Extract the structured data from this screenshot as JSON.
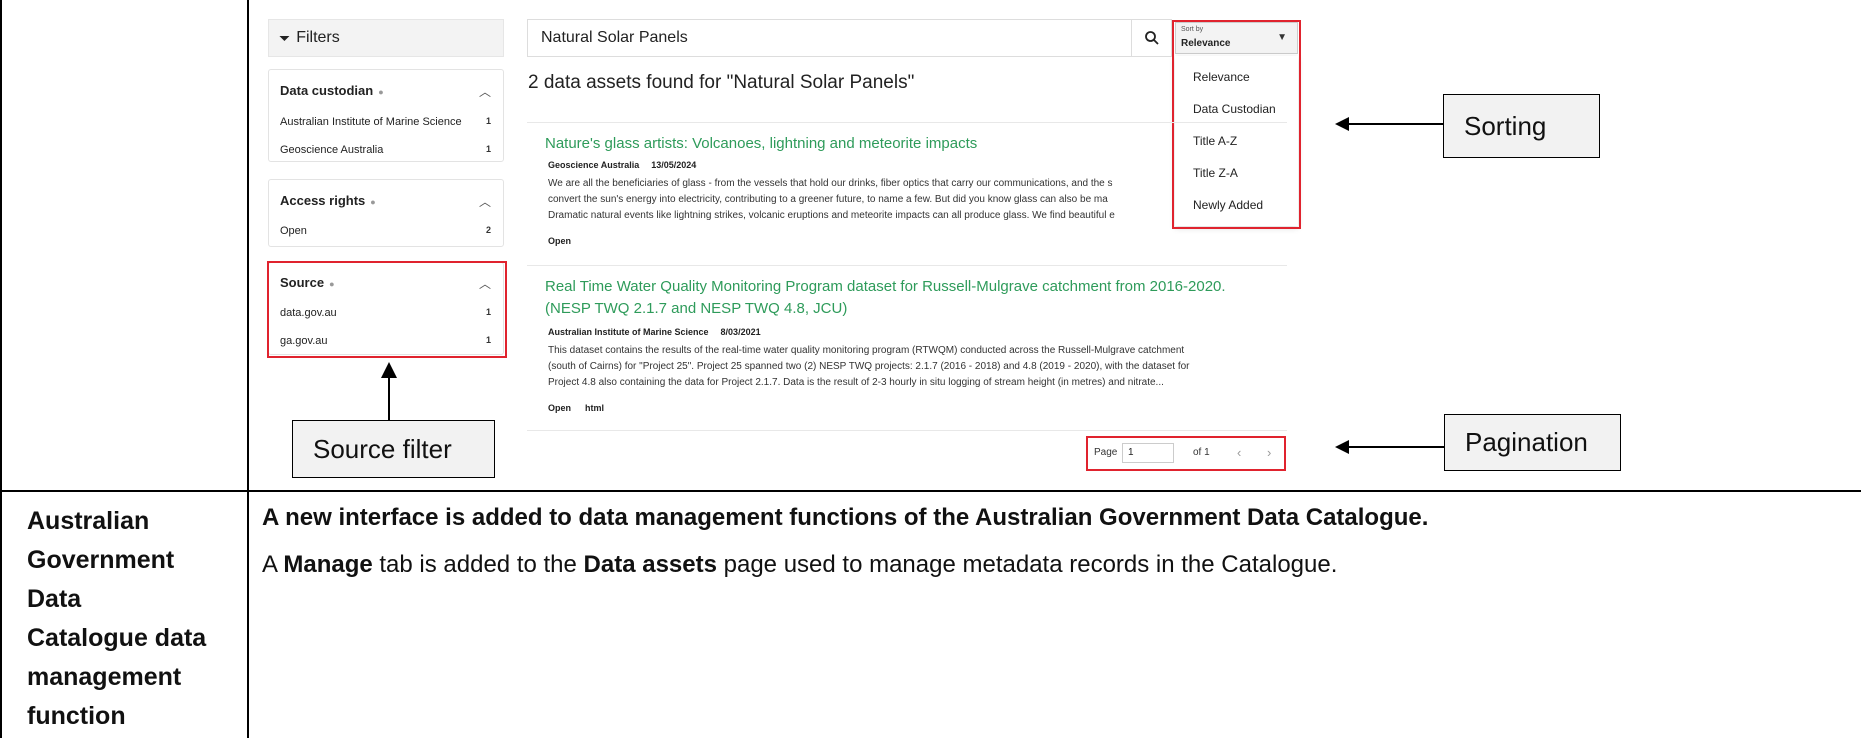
{
  "filters": {
    "title": "Filters",
    "groups": [
      {
        "title": "Data custodian",
        "items": [
          {
            "label": "Australian Institute of Marine Science",
            "count": "1"
          },
          {
            "label": "Geoscience Australia",
            "count": "1"
          }
        ]
      },
      {
        "title": "Access rights",
        "items": [
          {
            "label": "Open",
            "count": "2"
          }
        ]
      },
      {
        "title": "Source",
        "items": [
          {
            "label": "data.gov.au",
            "count": "1"
          },
          {
            "label": "ga.gov.au",
            "count": "1"
          }
        ]
      }
    ]
  },
  "search": {
    "value": "Natural Solar Panels",
    "results_text": "2 data assets found for \"Natural Solar Panels\""
  },
  "sort": {
    "label": "Sort by",
    "selected": "Relevance",
    "options": [
      "Relevance",
      "Data Custodian",
      "Title A-Z",
      "Title Z-A",
      "Newly Added"
    ]
  },
  "results": [
    {
      "title": "Nature's glass artists: Volcanoes, lightning and meteorite impacts",
      "custodian": "Geoscience Australia",
      "date": "13/05/2024",
      "lines": [
        "We are all the beneficiaries of glass - from the vessels that hold our drinks, fiber optics that carry our communications, and the s",
        "convert the sun's energy into electricity, contributing to a greener future, to name a few. But did you know glass can also be ma",
        "Dramatic natural events like lightning strikes, volcanic eruptions and meteorite impacts can all produce glass. We find beautiful e"
      ],
      "tags": [
        "Open"
      ]
    },
    {
      "title_line1": "Real Time Water Quality Monitoring Program dataset for Russell-Mulgrave catchment from 2016-2020.",
      "title_line2": "(NESP TWQ 2.1.7 and NESP TWQ 4.8, JCU)",
      "custodian": "Australian Institute of Marine Science",
      "date": "8/03/2021",
      "lines": [
        "This dataset contains the results of the real-time water quality monitoring program (RTWQM) conducted across the Russell-Mulgrave catchment",
        "(south of Cairns) for \"Project 25\". Project 25 spanned two (2) NESP TWQ projects: 2.1.7 (2016 - 2018) and 4.8 (2019 - 2020), with the dataset for",
        "Project 4.8 also containing the data for Project 2.1.7. Data is the result of 2-3 hourly in situ logging of stream height (in metres) and nitrate..."
      ],
      "tags": [
        "Open",
        "html"
      ]
    }
  ],
  "pagination": {
    "page_label": "Page",
    "page_value": "1",
    "of_label": "of 1",
    "prev": "‹",
    "next": "›"
  },
  "callouts": {
    "sorting": "Sorting",
    "pagination": "Pagination",
    "source_filter": "Source filter"
  },
  "table_row": {
    "left_cell": [
      "Australian",
      "Government",
      "Data",
      "Catalogue data",
      "management",
      "function"
    ],
    "heading": "A new interface is added to data management functions of the Australian Government Data Catalogue.",
    "para": {
      "p1": "A ",
      "b1": "Manage",
      "p2": " tab is added to the ",
      "b2": "Data assets",
      "p3": " page used to manage metadata records in the Catalogue."
    }
  }
}
